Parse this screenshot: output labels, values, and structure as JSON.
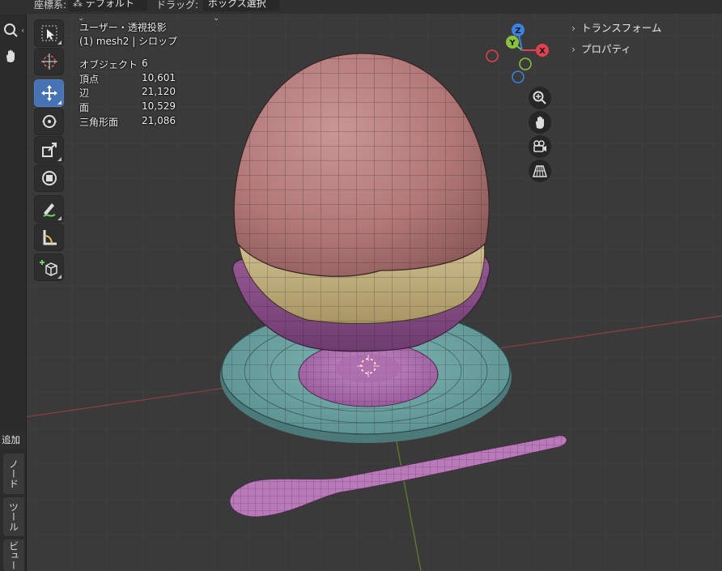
{
  "header": {
    "orientation_label": "座標系:",
    "orientation_value": "デフォルト",
    "drag_label": "ドラッグ:",
    "drag_value": "ボックス選択"
  },
  "viewport": {
    "view_name": "ユーザー・透視投影",
    "object_line": "(1) mesh2 | シロップ",
    "stats": [
      {
        "label": "オブジェクト",
        "value": "6"
      },
      {
        "label": "頂点",
        "value": "10,601"
      },
      {
        "label": "辺",
        "value": "21,120"
      },
      {
        "label": "面",
        "value": "10,529"
      },
      {
        "label": "三角形面",
        "value": "21,086"
      }
    ]
  },
  "toolbar": {
    "tools": [
      {
        "icon": "select-box-icon",
        "active": false
      },
      {
        "icon": "cursor-icon",
        "active": false
      },
      {
        "icon": "move-icon",
        "active": true
      },
      {
        "icon": "rotate-icon",
        "active": false
      },
      {
        "icon": "scale-icon",
        "active": false
      },
      {
        "icon": "transform-icon",
        "active": false
      },
      {
        "icon": "annotate-icon",
        "active": false
      },
      {
        "icon": "measure-icon",
        "active": false
      },
      {
        "icon": "add-cube-icon",
        "active": false
      }
    ]
  },
  "sidebar_panel": {
    "sections": [
      "トランスフォーム",
      "プロパティ"
    ]
  },
  "side_tabs": [
    "ノード",
    "ツール",
    "ビュー"
  ],
  "left_strip": {
    "add_label": "追加"
  },
  "gizmo": {
    "axes": [
      "X",
      "Y",
      "Z"
    ]
  },
  "colors": {
    "egg_top": "#bb7f7f",
    "egg_syrup": "#c9b786",
    "cup": "#8b4f8a",
    "saucer": "#6fa6a5",
    "stem": "#b474b6",
    "spoon": "#b97ab9",
    "active_tool": "#4772b3",
    "axis_x": "#e0434f",
    "axis_y": "#8ac33b",
    "axis_z": "#3c80e0"
  }
}
